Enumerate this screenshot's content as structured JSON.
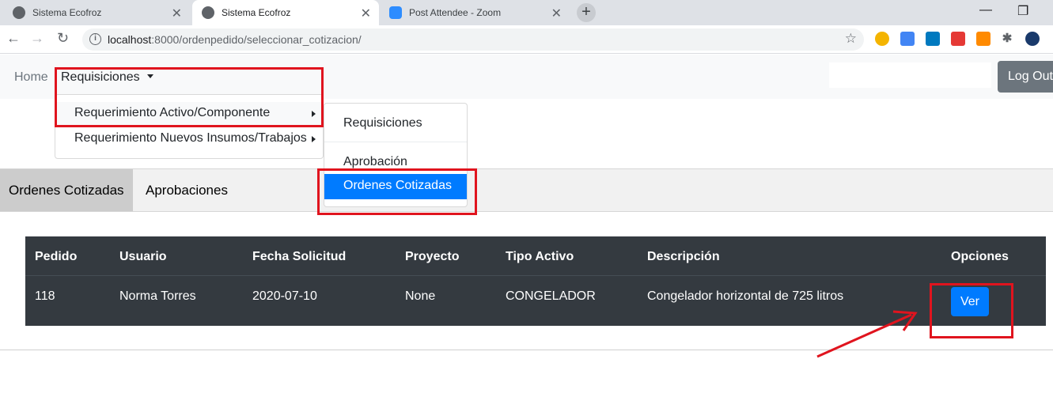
{
  "browser": {
    "tabs": [
      {
        "title": "Sistema Ecofroz"
      },
      {
        "title": "Sistema Ecofroz"
      },
      {
        "title": "Post Attendee - Zoom"
      }
    ],
    "url_host": "localhost",
    "url_path": ":8000/ordenpedido/seleccionar_cotizacion/"
  },
  "navbar": {
    "home": "Home",
    "requisiciones": "Requisiciones",
    "logout": "Log Out"
  },
  "dropdown": {
    "items": [
      {
        "label": "Requerimiento Activo/Componente"
      },
      {
        "label": "Requerimiento Nuevos Insumos/Trabajos"
      }
    ]
  },
  "submenu": {
    "items": [
      {
        "label": "Requisiciones"
      },
      {
        "label": "Aprobación"
      },
      {
        "label": "Ordenes Cotizadas"
      }
    ]
  },
  "page_tabs": [
    {
      "label": "Ordenes Cotizadas"
    },
    {
      "label": "Aprobaciones"
    }
  ],
  "table": {
    "headers": [
      "Pedido",
      "Usuario",
      "Fecha Solicitud",
      "Proyecto",
      "Tipo Activo",
      "Descripción",
      "Opciones"
    ],
    "rows": [
      {
        "pedido": "118",
        "usuario": "Norma Torres",
        "fecha": "2020-07-10",
        "proyecto": "None",
        "tipo": "CONGELADOR",
        "descripcion": "Congelador horizontal de 725 litros",
        "action": "Ver"
      }
    ]
  },
  "colors": {
    "annotation_red": "#e0141e",
    "primary": "#007bff",
    "table_dark": "#343a40"
  }
}
